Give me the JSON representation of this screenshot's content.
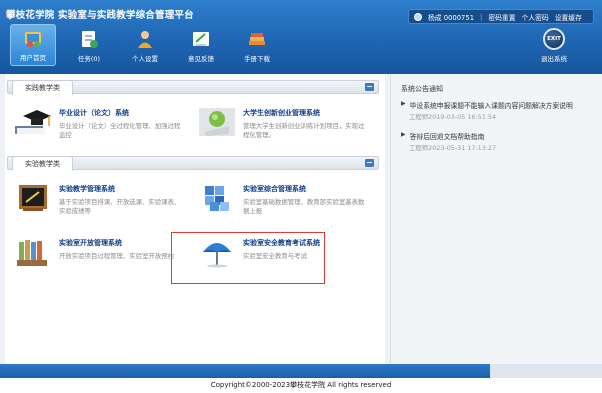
{
  "header": {
    "title": "攀枝花学院 实验室与实践教学综合管理平台",
    "user_name": "杨成 0000751",
    "links": [
      "密码重置",
      "个人密码",
      "设置缓存"
    ]
  },
  "nav": [
    {
      "label": "用户首页",
      "icon": "home-icon",
      "active": true
    },
    {
      "label": "任务(0)",
      "icon": "task-icon",
      "active": false
    },
    {
      "label": "个人设置",
      "icon": "person-icon",
      "active": false
    },
    {
      "label": "意见反馈",
      "icon": "feedback-icon",
      "active": false
    },
    {
      "label": "手册下载",
      "icon": "manual-icon",
      "active": false
    }
  ],
  "exit": {
    "icon_text": "EXIT",
    "label": "退出系统"
  },
  "sections": [
    {
      "title": "实践教学类",
      "collapse": "−",
      "systems": [
        {
          "name": "毕业设计（论文）系统",
          "desc": "毕业设计（论文）全过程化管理、加强过程监控",
          "icon": "graduation-cap-icon"
        },
        {
          "name": "大学生创新创业管理系统",
          "desc": "管理大学生创新创业训练计划项目，实现过程化管理。",
          "icon": "lightbulb-book-icon"
        }
      ]
    },
    {
      "title": "实验教学类",
      "collapse": "−",
      "systems": [
        {
          "name": "实验教学管理系统",
          "desc": "基于实验项目排课、开放选课、实验课表、实验成绩等",
          "icon": "blackboard-icon"
        },
        {
          "name": "实验室综合管理系统",
          "desc": "实验室基础数据管理、教育部实验室基表数据上报",
          "icon": "cubes-icon"
        },
        {
          "name": "实验室开放管理系统",
          "desc": "开放实验项目过程管理、实验室开放预约",
          "icon": "books-icon"
        },
        {
          "name": "实验室安全教育考试系统",
          "desc": "实验室安全教育与考试",
          "icon": "umbrella-icon"
        }
      ]
    }
  ],
  "notices": {
    "title": "系统公告通知",
    "items": [
      {
        "title": "毕设系统申报课题不能输入课题内容问题解决方案说明",
        "meta": "工程师2019-03-05 16:51:54"
      },
      {
        "title": "答辩后回退文档帮助指南",
        "meta": "工程师2023-05-31 17:13:27"
      }
    ]
  },
  "footer": {
    "copyright": "Copyright©2000-2023攀枝花学院 All rights reserved"
  },
  "colors": {
    "brand": "#1f66b3",
    "link": "#0e3d8a",
    "highlight": "#e53935"
  }
}
